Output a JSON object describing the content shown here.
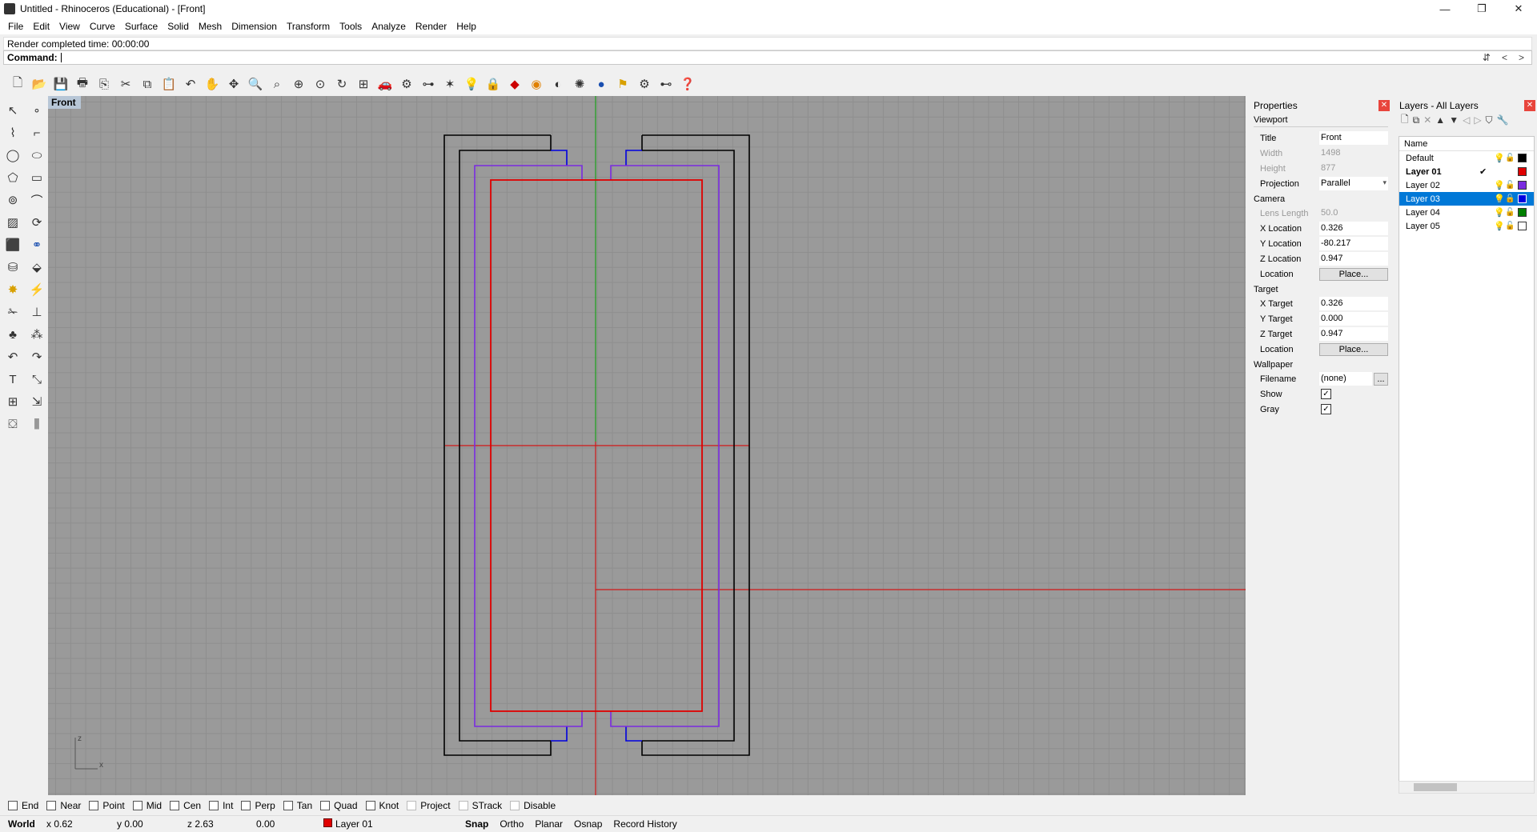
{
  "window": {
    "title": "Untitled - Rhinoceros (Educational) - [Front]",
    "minimize": "—",
    "restore": "❐",
    "close": "✕"
  },
  "menu": [
    "File",
    "Edit",
    "View",
    "Curve",
    "Surface",
    "Solid",
    "Mesh",
    "Dimension",
    "Transform",
    "Tools",
    "Analyze",
    "Render",
    "Help"
  ],
  "command": {
    "history": "Render completed time: 00:00:00",
    "prompt": "Command:"
  },
  "toolbar_icons": [
    "new-icon",
    "open-icon",
    "save-icon",
    "print-icon",
    "import-icon",
    "cut-icon",
    "copy-icon",
    "paste-icon",
    "undo-icon",
    "pan-icon",
    "rotate-icon",
    "zoom-icon",
    "zoom-window-icon",
    "zoom-extents-icon",
    "zoom-selected-icon",
    "rotate-view-icon",
    "viewport-layout-icon",
    "car-icon",
    "select-icon",
    "point-icon",
    "snap-icon",
    "light-icon",
    "lock-icon",
    "material-icon",
    "color-wheel-icon",
    "shade-icon",
    "render-icon",
    "sphere-icon",
    "flag-icon",
    "gear-icon",
    "network-icon",
    "help-icon"
  ],
  "viewport": {
    "title": "Front",
    "axis_z": "z",
    "axis_x": "x"
  },
  "properties": {
    "panel_title": "Properties",
    "viewport_label": "Viewport",
    "title_label": "Title",
    "title_value": "Front",
    "width_label": "Width",
    "width_value": "1498",
    "height_label": "Height",
    "height_value": "877",
    "projection_label": "Projection",
    "projection_value": "Parallel",
    "camera_label": "Camera",
    "lens_label": "Lens Length",
    "lens_value": "50.0",
    "xloc_label": "X Location",
    "xloc_value": "0.326",
    "yloc_label": "Y Location",
    "yloc_value": "-80.217",
    "zloc_label": "Z Location",
    "zloc_value": "0.947",
    "location_label": "Location",
    "place_label": "Place...",
    "target_label": "Target",
    "xt_label": "X Target",
    "xt_value": "0.326",
    "yt_label": "Y Target",
    "yt_value": "0.000",
    "zt_label": "Z Target",
    "zt_value": "0.947",
    "wallpaper_label": "Wallpaper",
    "filename_label": "Filename",
    "filename_value": "(none)",
    "browse_label": "...",
    "show_label": "Show",
    "gray_label": "Gray"
  },
  "layers": {
    "panel_title": "Layers - All Layers",
    "name_header": "Name",
    "items": [
      {
        "name": "Default",
        "color": "#000000"
      },
      {
        "name": "Layer 01",
        "color": "#e00000",
        "current": "✔"
      },
      {
        "name": "Layer 02",
        "color": "#7a2be0"
      },
      {
        "name": "Layer 03",
        "color": "#0000e0"
      },
      {
        "name": "Layer 04",
        "color": "#008000"
      },
      {
        "name": "Layer 05",
        "color": "#ffffff"
      }
    ]
  },
  "osnaps": [
    "End",
    "Near",
    "Point",
    "Mid",
    "Cen",
    "Int",
    "Perp",
    "Tan",
    "Quad",
    "Knot",
    "Project",
    "STrack",
    "Disable"
  ],
  "status": {
    "world": "World",
    "x": "x 0.62",
    "y": "y 0.00",
    "z": "z 2.63",
    "d": "0.00",
    "layer": "Layer 01",
    "snap": "Snap",
    "ortho": "Ortho",
    "planar": "Planar",
    "osnap": "Osnap",
    "history": "Record History"
  }
}
